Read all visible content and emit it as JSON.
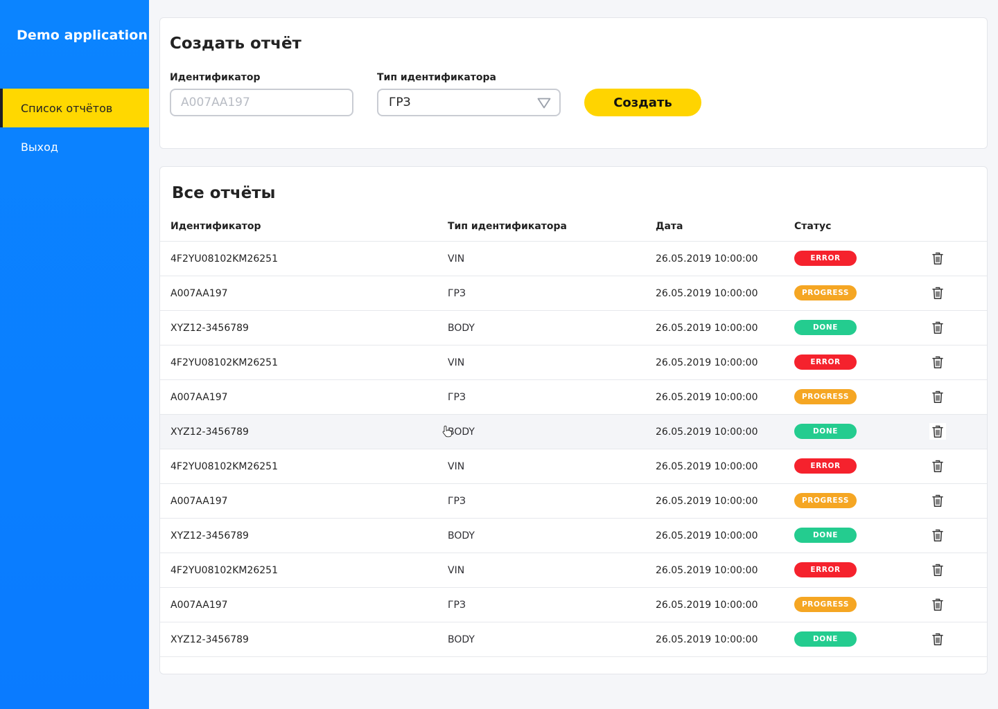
{
  "app": {
    "title": "Demo application"
  },
  "nav": {
    "items": [
      {
        "label": "Список отчётов",
        "active": true
      },
      {
        "label": "Выход",
        "active": false
      }
    ]
  },
  "create_form": {
    "title": "Создать отчёт",
    "identifier_label": "Идентификатор",
    "identifier_placeholder": "А007АА197",
    "identifier_value": "",
    "type_label": "Тип идентификатора",
    "type_value": "ГРЗ",
    "submit_label": "Создать"
  },
  "reports": {
    "title": "Все отчёты",
    "columns": [
      "Идентификатор",
      "Тип идентификатора",
      "Дата",
      "Статус"
    ],
    "rows": [
      {
        "id": "4F2YU08102KM26251",
        "type": "VIN",
        "date": "26.05.2019 10:00:00",
        "status": "ERROR"
      },
      {
        "id": "A007AA197",
        "type": "ГРЗ",
        "date": "26.05.2019 10:00:00",
        "status": "PROGRESS"
      },
      {
        "id": "XYZ12-3456789",
        "type": "BODY",
        "date": "26.05.2019 10:00:00",
        "status": "DONE"
      },
      {
        "id": "4F2YU08102KM26251",
        "type": "VIN",
        "date": "26.05.2019 10:00:00",
        "status": "ERROR"
      },
      {
        "id": "A007AA197",
        "type": "ГРЗ",
        "date": "26.05.2019 10:00:00",
        "status": "PROGRESS"
      },
      {
        "id": "XYZ12-3456789",
        "type": "BODY",
        "date": "26.05.2019 10:00:00",
        "status": "DONE"
      },
      {
        "id": "4F2YU08102KM26251",
        "type": "VIN",
        "date": "26.05.2019 10:00:00",
        "status": "ERROR"
      },
      {
        "id": "A007AA197",
        "type": "ГРЗ",
        "date": "26.05.2019 10:00:00",
        "status": "PROGRESS"
      },
      {
        "id": "XYZ12-3456789",
        "type": "BODY",
        "date": "26.05.2019 10:00:00",
        "status": "DONE"
      },
      {
        "id": "4F2YU08102KM26251",
        "type": "VIN",
        "date": "26.05.2019 10:00:00",
        "status": "ERROR"
      },
      {
        "id": "A007AA197",
        "type": "ГРЗ",
        "date": "26.05.2019 10:00:00",
        "status": "PROGRESS"
      },
      {
        "id": "XYZ12-3456789",
        "type": "BODY",
        "date": "26.05.2019 10:00:00",
        "status": "DONE"
      }
    ],
    "hovered_row": 5
  },
  "status_colors": {
    "ERROR": "#f5222d",
    "PROGRESS": "#f5a623",
    "DONE": "#24cc8f"
  },
  "colors": {
    "sidebar": "#0a7eff",
    "accent": "#ffd600"
  },
  "icons": {
    "delete": "trash-icon",
    "select": "triangle-down-icon",
    "cursor": "hand-pointer-icon"
  }
}
